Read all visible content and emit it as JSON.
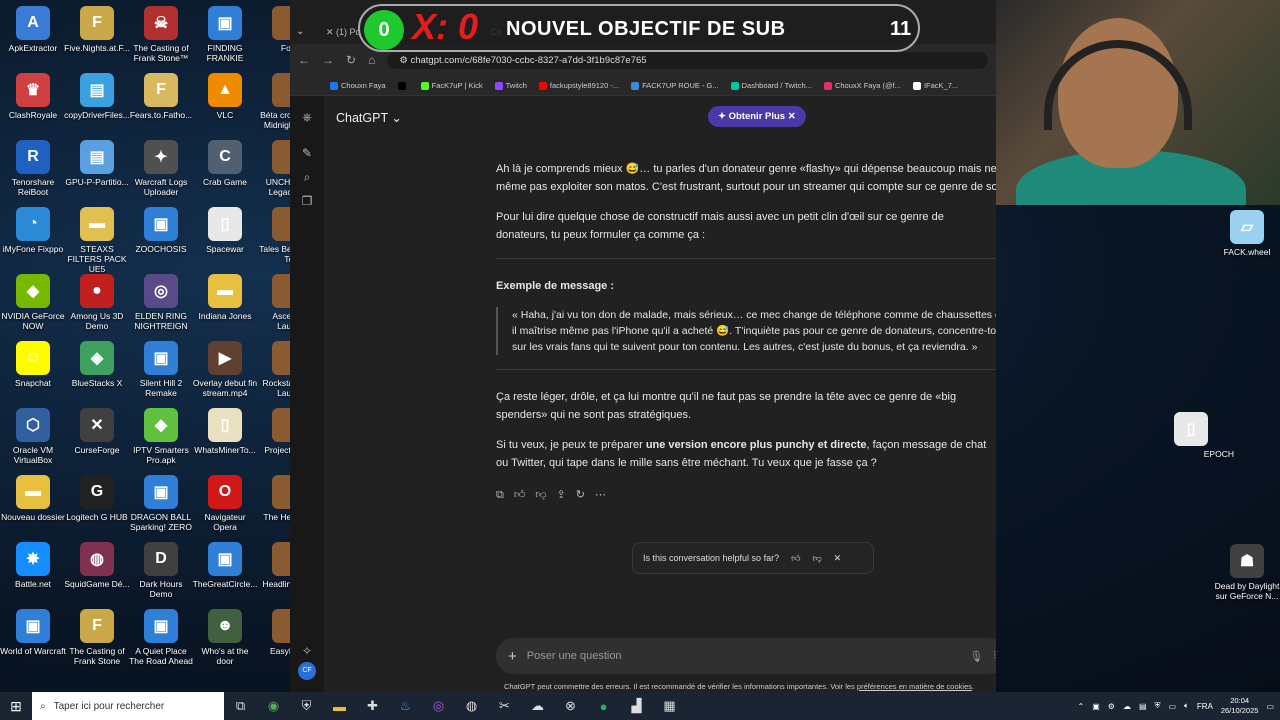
{
  "desktop": {
    "icons": [
      {
        "label": "ApkExtractor",
        "color": "#3a7bd5",
        "glyph": "A"
      },
      {
        "label": "Five.Nights.at.F...",
        "color": "#c8a848",
        "glyph": "F"
      },
      {
        "label": "The Casting of Frank Stone™",
        "color": "#b03030",
        "glyph": "☠"
      },
      {
        "label": "FINDING FRANKIE",
        "color": "#2f7fd6",
        "glyph": "▣"
      },
      {
        "label": "ClashRoyale",
        "color": "#d04040",
        "glyph": "♛"
      },
      {
        "label": "copyDriverFiles...",
        "color": "#3aa0e0",
        "glyph": "▤"
      },
      {
        "label": "Fears.to.Fatho...",
        "color": "#d8b860",
        "glyph": "F"
      },
      {
        "label": "VLC",
        "color": "#f08a00",
        "glyph": "▲"
      },
      {
        "label": "Tenorshare ReiBoot",
        "color": "#2060c0",
        "glyph": "R"
      },
      {
        "label": "GPU-P-Partitio...",
        "color": "#5aa0e0",
        "glyph": "▤"
      },
      {
        "label": "Warcraft Logs Uploader",
        "color": "#505050",
        "glyph": "✦"
      },
      {
        "label": "Crab Game",
        "color": "#506070",
        "glyph": "C"
      },
      {
        "label": "iMyFone Fixppo",
        "color": "#2a8ad8",
        "glyph": "◔"
      },
      {
        "label": "STEAXS FILTERS PACK UE5",
        "color": "#e0c050",
        "glyph": "▬"
      },
      {
        "label": "ZOOCHOSIS",
        "color": "#2f7fd6",
        "glyph": "▣"
      },
      {
        "label": "Spacewar",
        "color": "#e8e8e8",
        "glyph": "▯"
      },
      {
        "label": "NVIDIA GeForce NOW",
        "color": "#76b900",
        "glyph": "◆"
      },
      {
        "label": "Among Us 3D Demo",
        "color": "#c02020",
        "glyph": "●"
      },
      {
        "label": "ELDEN RING NIGHTREIGN",
        "color": "#5a4a8a",
        "glyph": "◎"
      },
      {
        "label": "Indiana Jones",
        "color": "#e8c040",
        "glyph": "▬"
      },
      {
        "label": "Snapchat",
        "color": "#fffc00",
        "glyph": "☺"
      },
      {
        "label": "BlueStacks X",
        "color": "#40a060",
        "glyph": "◈"
      },
      {
        "label": "Silent Hill 2 Remake",
        "color": "#2f7fd6",
        "glyph": "▣"
      },
      {
        "label": "Overlay debut fin stream.mp4",
        "color": "#604030",
        "glyph": "▶"
      },
      {
        "label": "Oracle VM VirtualBox",
        "color": "#3060a0",
        "glyph": "⬡"
      },
      {
        "label": "CurseForge",
        "color": "#404040",
        "glyph": "✕"
      },
      {
        "label": "IPTV Smarters Pro.apk",
        "color": "#60c040",
        "glyph": "◆"
      },
      {
        "label": "WhatsMinerTo...",
        "color": "#e8e0c0",
        "glyph": "▯"
      },
      {
        "label": "Nouveau dossier",
        "color": "#e8c040",
        "glyph": "▬"
      },
      {
        "label": "Logitech G HUB",
        "color": "#222222",
        "glyph": "G"
      },
      {
        "label": "DRAGON BALL Sparking! ZERO",
        "color": "#2f7fd6",
        "glyph": "▣"
      },
      {
        "label": "Navigateur Opera",
        "color": "#d01818",
        "glyph": "O"
      },
      {
        "label": "Battle.net",
        "color": "#148eff",
        "glyph": "✸"
      },
      {
        "label": "SquidGame Dé...",
        "color": "#803050",
        "glyph": "◍"
      },
      {
        "label": "Dark Hours Demo",
        "color": "#404040",
        "glyph": "D"
      },
      {
        "label": "TheGreatCircle...",
        "color": "#2f7fd6",
        "glyph": "▣"
      },
      {
        "label": "World of Warcraft",
        "color": "#2f7fd6",
        "glyph": "▣"
      },
      {
        "label": "The Casting of Frank Stone",
        "color": "#c8a848",
        "glyph": "F"
      },
      {
        "label": "A Quiet Place The Road Ahead",
        "color": "#2f7fd6",
        "glyph": "▣"
      },
      {
        "label": "Who's at the door",
        "color": "#406040",
        "glyph": "☻"
      }
    ],
    "partial_col": [
      "Fort",
      "Béta cros Midnight",
      "UNCHA Legacy",
      "Tales Bey Tor",
      "Ascen Laun",
      "Rockstar Laun",
      "ProjectZ",
      "The Hea",
      "Headline",
      "EasyM"
    ],
    "right_icons": [
      {
        "label": "FACK.wheel"
      },
      {
        "label": "EPOCH"
      },
      {
        "label": "Dead by Daylight sur GeForce N..."
      }
    ]
  },
  "overlay": {
    "count": "0",
    "x_label": "X: 0",
    "title": "NOUVEL OBJECTIF DE SUB",
    "goal": "11"
  },
  "browser": {
    "tabs": [
      "(1) Po",
      "Co"
    ],
    "url": "chatgpt.com/c/68fe7030-ccbc-8327-a7dd-3f1b9c87e765",
    "bookmarks": [
      {
        "label": "Chouxn Faya",
        "color": "#1877f2"
      },
      {
        "label": "",
        "color": "#000000"
      },
      {
        "label": "FacK7uP | Kick",
        "color": "#53fc18"
      },
      {
        "label": "Twitch",
        "color": "#9146ff"
      },
      {
        "label": "fackupstyle89120 -...",
        "color": "#ff0000"
      },
      {
        "label": "FACK7UP ROUE - G...",
        "color": "#3a8ad8"
      },
      {
        "label": "Dashboard / Twitch...",
        "color": "#00c8a0"
      },
      {
        "label": "ChouxX Faya (@f...",
        "color": "#e1306c"
      },
      {
        "label": "IFacK_7...",
        "color": "#ffffff"
      }
    ]
  },
  "chatgpt": {
    "model": "ChatGPT",
    "upgrade": "Obtenir Plus",
    "paragraphs": {
      "p1_line1": "Ah là je comprends mieux 😅… tu parles d'un donateur genre «flashy» qui dépense beaucoup mais ne sai",
      "p1_line2": "même pas exploiter son matos. C'est frustrant, surtout pour un streamer qui compte sur ce genre de soutie",
      "p2": "Pour lui dire quelque chose de constructif mais aussi avec un petit clin d'œil sur ce genre de donateurs, tu peux formuler ça comme ça :",
      "heading": "Exemple de message :",
      "quote": "« Haha, j'ai vu ton don de malade, mais sérieux… ce mec change de téléphone comme de chaussettes et il maîtrise même pas l'iPhone qu'il a acheté 😅. T'inquiète pas pour ce genre de donateurs, concentre-toi sur les vrais fans qui te suivent pour ton contenu. Les autres, c'est juste du bonus, et ça reviendra. »",
      "p3": "Ça reste léger, drôle, et ça lui montre qu'il ne faut pas se prendre la tête avec ce genre de «big spenders» qui ne sont pas stratégiques.",
      "p4_pre": "Si tu veux, je peux te préparer ",
      "p4_bold": "une version encore plus punchy et directe",
      "p4_post": ", façon message de chat ou Twitter, qui tape dans le mille sans être méchant. Tu veux que je fasse ça ?"
    },
    "helpful_prompt": "Is this conversation helpful so far?",
    "composer_placeholder": "Poser une question",
    "disclaimer_pre": "ChatGPT peut commettre des erreurs. Il est recommandé de vérifier les informations importantes. Voir les ",
    "disclaimer_link": "préférences en matière de cookies",
    "disclaimer_post": ".",
    "avatar_initials": "CF"
  },
  "taskbar": {
    "search_placeholder": "Taper ici pour rechercher",
    "language": "FRA",
    "time": "20:04",
    "date": "26/10/2025"
  }
}
